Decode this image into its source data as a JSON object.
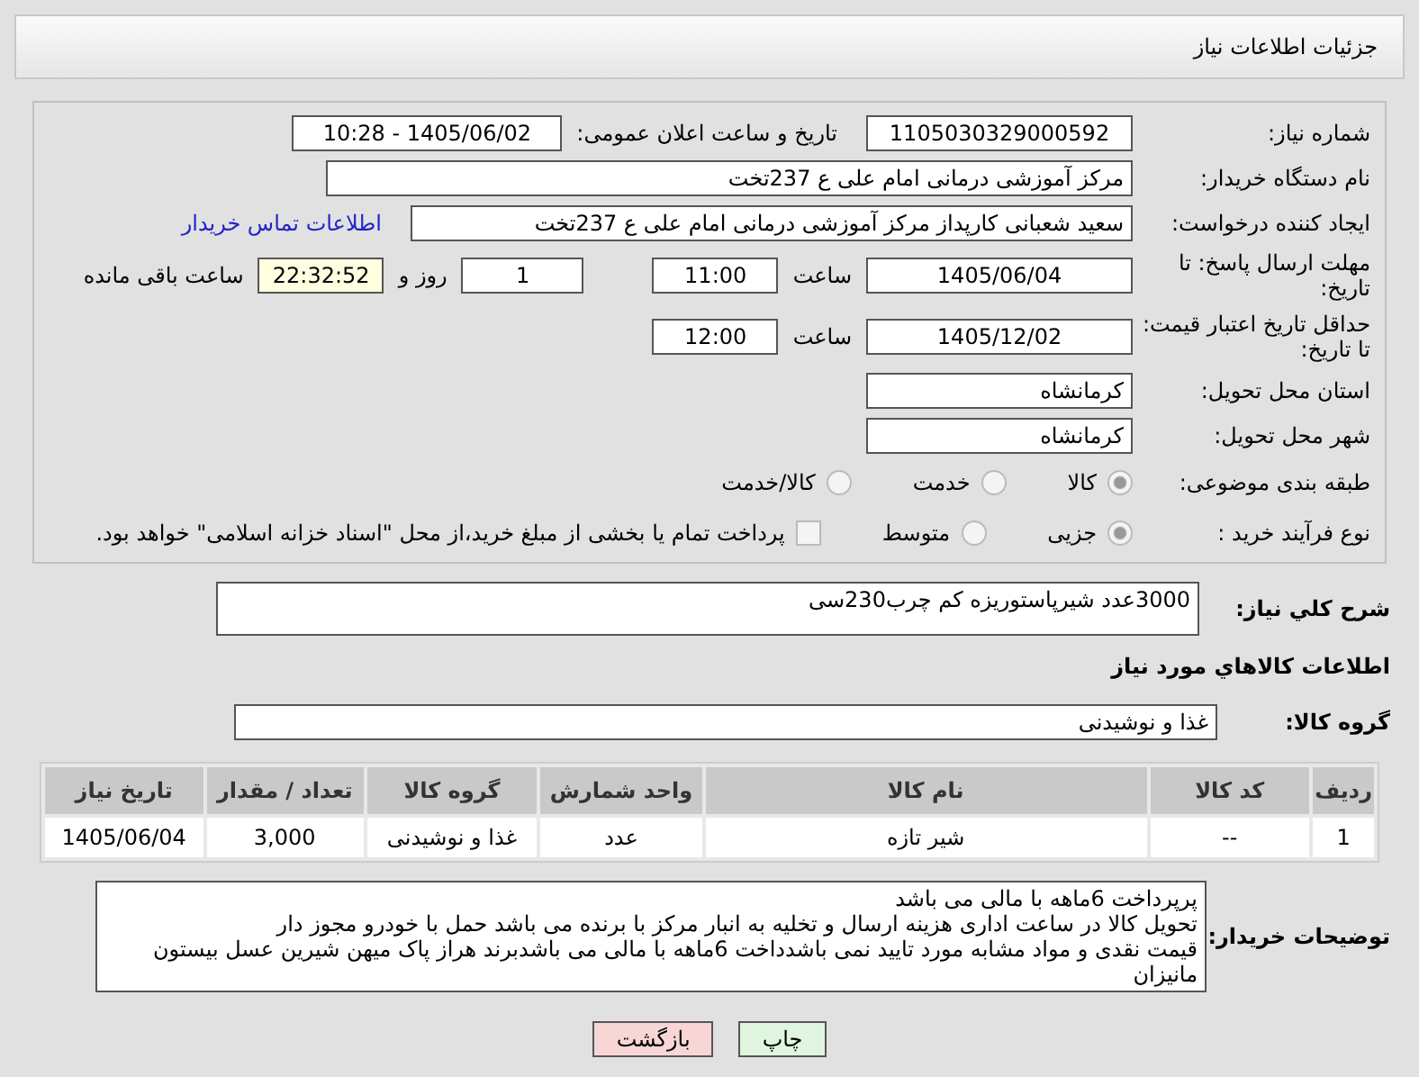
{
  "header": {
    "title": "جزئیات اطلاعات نیاز"
  },
  "need_number": {
    "label": "شماره نیاز:",
    "value": "1105030329000592"
  },
  "announce": {
    "label": "تاریخ و ساعت اعلان عمومی:",
    "value": "1405/06/02 - 10:28"
  },
  "buyer_org": {
    "label": "نام دستگاه خریدار:",
    "value": "مرکز آموزشی درمانی امام علی ع 237تخت"
  },
  "requester": {
    "label": "ایجاد کننده درخواست:",
    "value": "سعید شعبانی کارپداز  مرکز آموزشی درمانی امام علی ع 237تخت",
    "link": "اطلاعات تماس خریدار"
  },
  "deadline": {
    "label": "مهلت ارسال پاسخ: تا تاریخ:",
    "date": "1405/06/04",
    "time_label": "ساعت",
    "time": "11:00",
    "days": "1",
    "days_label": "روز و",
    "remaining": "22:32:52",
    "remaining_label": "ساعت باقی مانده"
  },
  "validity": {
    "label": "حداقل تاریخ اعتبار قیمت: تا تاریخ:",
    "date": "1405/12/02",
    "time_label": "ساعت",
    "time": "12:00"
  },
  "province": {
    "label": "استان محل تحویل:",
    "value": "کرمانشاه"
  },
  "city": {
    "label": "شهر محل تحویل:",
    "value": "کرمانشاه"
  },
  "category": {
    "label": "طبقه بندی موضوعی:",
    "options": [
      {
        "label": "کالا",
        "selected": true
      },
      {
        "label": "خدمت",
        "selected": false
      },
      {
        "label": "کالا/خدمت",
        "selected": false
      }
    ]
  },
  "process": {
    "label": "نوع فرآیند خرید :",
    "options": [
      {
        "label": "جزیی",
        "selected": true
      },
      {
        "label": "متوسط",
        "selected": false
      }
    ],
    "payment": {
      "label": "پرداخت تمام یا بخشی از مبلغ خرید،از محل \"اسناد خزانه اسلامی\" خواهد بود.",
      "checked": false
    }
  },
  "description": {
    "label": "شرح کلي نیاز:",
    "value": "3000عدد شیرپاستوریزه کم چرب230سی"
  },
  "goods_title": "اطلاعات کالاهاي مورد نیاز",
  "goods_group": {
    "label": "گروه کالا:",
    "value": "غذا و نوشیدنی"
  },
  "table": {
    "columns": [
      "ردیف",
      "کد کالا",
      "نام کالا",
      "واحد شمارش",
      "گروه کالا",
      "تعداد / مقدار",
      "تاریخ نیاز"
    ],
    "rows": [
      [
        "1",
        "--",
        "شیر تازه",
        "عدد",
        "غذا و نوشیدنی",
        "3,000",
        "1405/06/04"
      ]
    ]
  },
  "notes": {
    "label": "توضیحات خریدار:",
    "lines": [
      "پرپرداخت 6ماهه با مالی می باشد",
      "تحویل کالا در ساعت اداری هزینه ارسال و تخلیه به انبار مرکز با برنده می باشد حمل با خودرو مجوز دار",
      "قیمت نقدی و مواد مشابه مورد تایید نمی باشدداخت 6ماهه با مالی می باشدبرند هراز پاک میهن شیرین عسل بیستون",
      "مانیزان"
    ]
  },
  "buttons": [
    {
      "label": "چاپ",
      "kind": "print"
    },
    {
      "label": "بازگشت",
      "kind": "back"
    }
  ]
}
